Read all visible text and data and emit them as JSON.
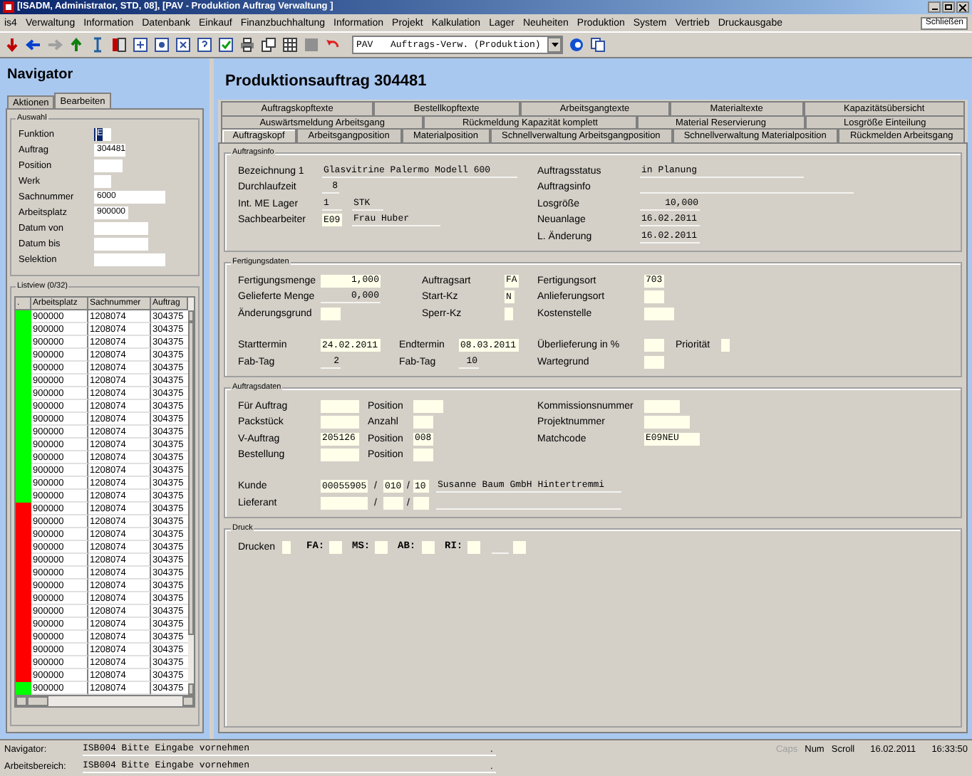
{
  "window": {
    "title": "[ISADM, Administrator, STD, 08], [PAV - Produktion Auftrag Verwaltung ]"
  },
  "menu": [
    "is4",
    "Verwaltung",
    "Information",
    "Datenbank",
    "Einkauf",
    "Finanzbuchhaltung",
    "Information",
    "Projekt",
    "Kalkulation",
    "Lager",
    "Neuheiten",
    "Produktion",
    "System",
    "Vertrieb",
    "Druckausgabe"
  ],
  "close_button": "Schließen",
  "toolbar": {
    "combo_code": "PAV",
    "combo_text": "Auftrags-Verw. (Produktion)"
  },
  "navigator": {
    "title": "Navigator",
    "tabs": [
      {
        "label": "Aktionen",
        "selected": false
      },
      {
        "label": "Bearbeiten",
        "selected": true
      }
    ],
    "selection": {
      "title": "Auswahl",
      "fields": [
        {
          "label": "Funktion",
          "value": "E",
          "highlighted": true
        },
        {
          "label": "Auftrag",
          "value": "304481",
          "highlighted": false
        },
        {
          "label": "Position",
          "highlighted": false
        },
        {
          "label": "Werk",
          "highlighted": false
        },
        {
          "label": "Sachnummer",
          "value": "6000",
          "highlighted": false
        },
        {
          "label": "Arbeitsplatz",
          "value": "900000",
          "highlighted": false
        },
        {
          "label": "Datum von",
          "highlighted": false
        },
        {
          "label": "Datum bis",
          "highlighted": false
        },
        {
          "label": "Selektion",
          "highlighted": false
        }
      ]
    },
    "listview": {
      "title": "Listview (0/32)",
      "columns": [
        ".",
        "Arbeitsplatz",
        "Sachnummer",
        "Auftrag"
      ],
      "rows": [
        {
          "color": "#00ff00",
          "arbeitsplatz": "900000",
          "sachnummer": "1208074",
          "auftrag": "304375"
        },
        {
          "color": "#00ff00",
          "arbeitsplatz": "900000",
          "sachnummer": "1208074",
          "auftrag": "304375"
        },
        {
          "color": "#00ff00",
          "arbeitsplatz": "900000",
          "sachnummer": "1208074",
          "auftrag": "304375"
        },
        {
          "color": "#00ff00",
          "arbeitsplatz": "900000",
          "sachnummer": "1208074",
          "auftrag": "304375"
        },
        {
          "color": "#00ff00",
          "arbeitsplatz": "900000",
          "sachnummer": "1208074",
          "auftrag": "304375"
        },
        {
          "color": "#00ff00",
          "arbeitsplatz": "900000",
          "sachnummer": "1208074",
          "auftrag": "304375"
        },
        {
          "color": "#00ff00",
          "arbeitsplatz": "900000",
          "sachnummer": "1208074",
          "auftrag": "304375"
        },
        {
          "color": "#00ff00",
          "arbeitsplatz": "900000",
          "sachnummer": "1208074",
          "auftrag": "304375"
        },
        {
          "color": "#00ff00",
          "arbeitsplatz": "900000",
          "sachnummer": "1208074",
          "auftrag": "304375"
        },
        {
          "color": "#00ff00",
          "arbeitsplatz": "900000",
          "sachnummer": "1208074",
          "auftrag": "304375"
        },
        {
          "color": "#00ff00",
          "arbeitsplatz": "900000",
          "sachnummer": "1208074",
          "auftrag": "304375"
        },
        {
          "color": "#00ff00",
          "arbeitsplatz": "900000",
          "sachnummer": "1208074",
          "auftrag": "304375"
        },
        {
          "color": "#00ff00",
          "arbeitsplatz": "900000",
          "sachnummer": "1208074",
          "auftrag": "304375"
        },
        {
          "color": "#00ff00",
          "arbeitsplatz": "900000",
          "sachnummer": "1208074",
          "auftrag": "304375"
        },
        {
          "color": "#00ff00",
          "arbeitsplatz": "900000",
          "sachnummer": "1208074",
          "auftrag": "304375"
        },
        {
          "color": "#ff0000",
          "arbeitsplatz": "900000",
          "sachnummer": "1208074",
          "auftrag": "304375"
        },
        {
          "color": "#ff0000",
          "arbeitsplatz": "900000",
          "sachnummer": "1208074",
          "auftrag": "304375"
        },
        {
          "color": "#ff0000",
          "arbeitsplatz": "900000",
          "sachnummer": "1208074",
          "auftrag": "304375"
        },
        {
          "color": "#ff0000",
          "arbeitsplatz": "900000",
          "sachnummer": "1208074",
          "auftrag": "304375"
        },
        {
          "color": "#ff0000",
          "arbeitsplatz": "900000",
          "sachnummer": "1208074",
          "auftrag": "304375"
        },
        {
          "color": "#ff0000",
          "arbeitsplatz": "900000",
          "sachnummer": "1208074",
          "auftrag": "304375"
        },
        {
          "color": "#ff0000",
          "arbeitsplatz": "900000",
          "sachnummer": "1208074",
          "auftrag": "304375"
        },
        {
          "color": "#ff0000",
          "arbeitsplatz": "900000",
          "sachnummer": "1208074",
          "auftrag": "304375"
        },
        {
          "color": "#ff0000",
          "arbeitsplatz": "900000",
          "sachnummer": "1208074",
          "auftrag": "304375"
        },
        {
          "color": "#ff0000",
          "arbeitsplatz": "900000",
          "sachnummer": "1208074",
          "auftrag": "304375"
        },
        {
          "color": "#ff0000",
          "arbeitsplatz": "900000",
          "sachnummer": "1208074",
          "auftrag": "304375"
        },
        {
          "color": "#ff0000",
          "arbeitsplatz": "900000",
          "sachnummer": "1208074",
          "auftrag": "304375"
        },
        {
          "color": "#ff0000",
          "arbeitsplatz": "900000",
          "sachnummer": "1208074",
          "auftrag": "304375"
        },
        {
          "color": "#ff0000",
          "arbeitsplatz": "900000",
          "sachnummer": "1208074",
          "auftrag": "304375"
        },
        {
          "color": "#00ff00",
          "arbeitsplatz": "900000",
          "sachnummer": "1208074",
          "auftrag": "304375"
        }
      ]
    }
  },
  "main": {
    "title": "Produktionsauftrag 304481",
    "tab_rows": [
      [
        {
          "label": "Auftragskopftexte",
          "selected": false
        },
        {
          "label": "Bestellkopftexte",
          "selected": false
        },
        {
          "label": "Arbeitsgangtexte",
          "selected": false
        },
        {
          "label": "Materialtexte",
          "selected": false
        },
        {
          "label": "Kapazitätsübersicht",
          "selected": false
        }
      ],
      [
        {
          "label": "Auswärtsmeldung Arbeitsgang",
          "selected": false
        },
        {
          "label": "Rückmeldung Kapazität komplett",
          "selected": false
        },
        {
          "label": "Material Reservierung",
          "selected": false
        },
        {
          "label": "Losgröße Einteilung",
          "selected": false
        }
      ],
      [
        {
          "label": "Auftragskopf",
          "selected": true
        },
        {
          "label": "Arbeitsgangposition",
          "selected": false
        },
        {
          "label": "Materialposition",
          "selected": false
        },
        {
          "label": "Schnellverwaltung Arbeitsgangposition",
          "selected": false
        },
        {
          "label": "Schnellverwaltung Materialposition",
          "selected": false
        },
        {
          "label": "Rückmelden Arbeitsgang",
          "selected": false
        }
      ]
    ],
    "groups": [
      {
        "title": "Auftragsinfo",
        "rows": [
          [
            {
              "kind": "label",
              "text": "Bezeichnung 1"
            },
            {
              "kind": "display",
              "value": "Glasvitrine Palermo Modell 600"
            },
            {
              "kind": "gap"
            },
            {
              "kind": "label",
              "text": "Auftragsstatus"
            },
            {
              "kind": "display",
              "value": "in Planung"
            }
          ],
          [
            {
              "kind": "label",
              "text": "Durchlaufzeit"
            },
            {
              "kind": "display",
              "value": "8"
            },
            {
              "kind": "gap"
            },
            {
              "kind": "label",
              "text": "Auftragsinfo"
            },
            {
              "kind": "display"
            }
          ],
          [
            {
              "kind": "label",
              "text": "Int. ME Lager"
            },
            {
              "kind": "display",
              "value": "1"
            },
            {
              "kind": "display",
              "value": "STK"
            },
            {
              "kind": "label",
              "text": "Losgröße"
            },
            {
              "kind": "display",
              "value": "10,000"
            }
          ],
          [
            {
              "kind": "label",
              "text": "Sachbearbeiter"
            },
            {
              "kind": "field",
              "value": "E09"
            },
            {
              "kind": "display",
              "value": "Frau Huber"
            },
            {
              "kind": "label",
              "text": "Neuanlage"
            },
            {
              "kind": "display",
              "value": "16.02.2011"
            }
          ],
          [
            {
              "kind": "gap"
            },
            {
              "kind": "gap"
            },
            {
              "kind": "gap"
            },
            {
              "kind": "label",
              "text": "L. Änderung"
            },
            {
              "kind": "display",
              "value": "16.02.2011"
            }
          ]
        ]
      },
      {
        "title": "Fertigungsdaten",
        "rows": [
          [
            {
              "kind": "label",
              "text": "Fertigungsmenge"
            },
            {
              "kind": "field",
              "value": "1,000"
            },
            {
              "kind": "label",
              "text": "Auftragsart"
            },
            {
              "kind": "field",
              "value": "FA"
            },
            {
              "kind": "label",
              "text": "Fertigungsort"
            },
            {
              "kind": "field",
              "value": "703"
            }
          ],
          [
            {
              "kind": "label",
              "text": "Gelieferte Menge"
            },
            {
              "kind": "display",
              "value": "0,000"
            },
            {
              "kind": "label",
              "text": "Start-Kz"
            },
            {
              "kind": "field",
              "value": "N"
            },
            {
              "kind": "label",
              "text": "Anlieferungsort"
            },
            {
              "kind": "field"
            }
          ],
          [
            {
              "kind": "label",
              "text": "Änderungsgrund"
            },
            {
              "kind": "field"
            },
            {
              "kind": "label",
              "text": "Sperr-Kz"
            },
            {
              "kind": "field"
            },
            {
              "kind": "label",
              "text": "Kostenstelle"
            },
            {
              "kind": "field"
            }
          ],
          [
            {
              "kind": "label",
              "text": "Starttermin"
            },
            {
              "kind": "field",
              "value": "24.02.2011"
            },
            {
              "kind": "label",
              "text": "Endtermin"
            },
            {
              "kind": "field",
              "value": "08.03.2011"
            },
            {
              "kind": "label",
              "text": "Überlieferung in %"
            },
            {
              "kind": "field"
            },
            {
              "kind": "label",
              "text": "Priorität"
            },
            {
              "kind": "field"
            }
          ],
          [
            {
              "kind": "label",
              "text": "Fab-Tag"
            },
            {
              "kind": "display",
              "value": "2"
            },
            {
              "kind": "label",
              "text": "Fab-Tag"
            },
            {
              "kind": "display",
              "value": "10"
            },
            {
              "kind": "label",
              "text": "Wartegrund"
            },
            {
              "kind": "field"
            }
          ]
        ]
      },
      {
        "title": "Auftragsdaten",
        "rows": [
          [
            {
              "kind": "label",
              "text": "Für Auftrag"
            },
            {
              "kind": "field"
            },
            {
              "kind": "label",
              "text": "Position"
            },
            {
              "kind": "field"
            },
            {
              "kind": "label",
              "text": "Kommissionsnummer"
            },
            {
              "kind": "field"
            }
          ],
          [
            {
              "kind": "label",
              "text": "Packstück"
            },
            {
              "kind": "field"
            },
            {
              "kind": "label",
              "text": "Anzahl"
            },
            {
              "kind": "field"
            },
            {
              "kind": "label",
              "text": "Projektnummer"
            },
            {
              "kind": "field"
            }
          ],
          [
            {
              "kind": "label",
              "text": "V-Auftrag"
            },
            {
              "kind": "field",
              "value": "205126"
            },
            {
              "kind": "label",
              "text": "Position"
            },
            {
              "kind": "field",
              "value": "008"
            },
            {
              "kind": "label",
              "text": "Matchcode"
            },
            {
              "kind": "field",
              "value": "E09NEU"
            }
          ],
          [
            {
              "kind": "label",
              "text": "Bestellung"
            },
            {
              "kind": "field"
            },
            {
              "kind": "label",
              "text": "Position"
            },
            {
              "kind": "field"
            }
          ]
        ],
        "party_rows": [
          [
            {
              "kind": "label",
              "text": "Kunde"
            },
            {
              "kind": "field",
              "value": "00055905"
            },
            {
              "kind": "slash",
              "text": "/"
            },
            {
              "kind": "field",
              "value": "010"
            },
            {
              "kind": "slash",
              "text": "/"
            },
            {
              "kind": "field",
              "value": "10"
            },
            {
              "kind": "display",
              "value": "Susanne Baum GmbH Hintertremmi"
            }
          ],
          [
            {
              "kind": "label",
              "text": "Lieferant"
            },
            {
              "kind": "field"
            },
            {
              "kind": "slash",
              "text": "/"
            },
            {
              "kind": "field"
            },
            {
              "kind": "slash",
              "text": "/"
            },
            {
              "kind": "field"
            },
            {
              "kind": "display"
            }
          ]
        ]
      },
      {
        "title": "Druck",
        "rows": [
          [
            {
              "kind": "label",
              "text": "Drucken"
            },
            {
              "kind": "field"
            },
            {
              "kind": "code",
              "text": "FA:"
            },
            {
              "kind": "field"
            },
            {
              "kind": "code",
              "text": "MS:"
            },
            {
              "kind": "field"
            },
            {
              "kind": "code",
              "text": "AB:"
            },
            {
              "kind": "field"
            },
            {
              "kind": "code",
              "text": "RI:"
            },
            {
              "kind": "field"
            },
            {
              "kind": "display"
            },
            {
              "kind": "field"
            }
          ]
        ]
      }
    ]
  },
  "status_bar": {
    "lines": [
      {
        "label": "Navigator:",
        "message": "ISB004 Bitte Eingabe vornehmen",
        "mark": "."
      },
      {
        "label": "Arbeitsbereich:",
        "message": "ISB004 Bitte Eingabe vornehmen",
        "mark": "."
      }
    ],
    "indicators": [
      {
        "label": "Caps",
        "on": false
      },
      {
        "label": "Num",
        "on": true
      },
      {
        "label": "Scroll",
        "on": true
      }
    ],
    "date": "16.02.2011",
    "time": "16:33:50"
  }
}
